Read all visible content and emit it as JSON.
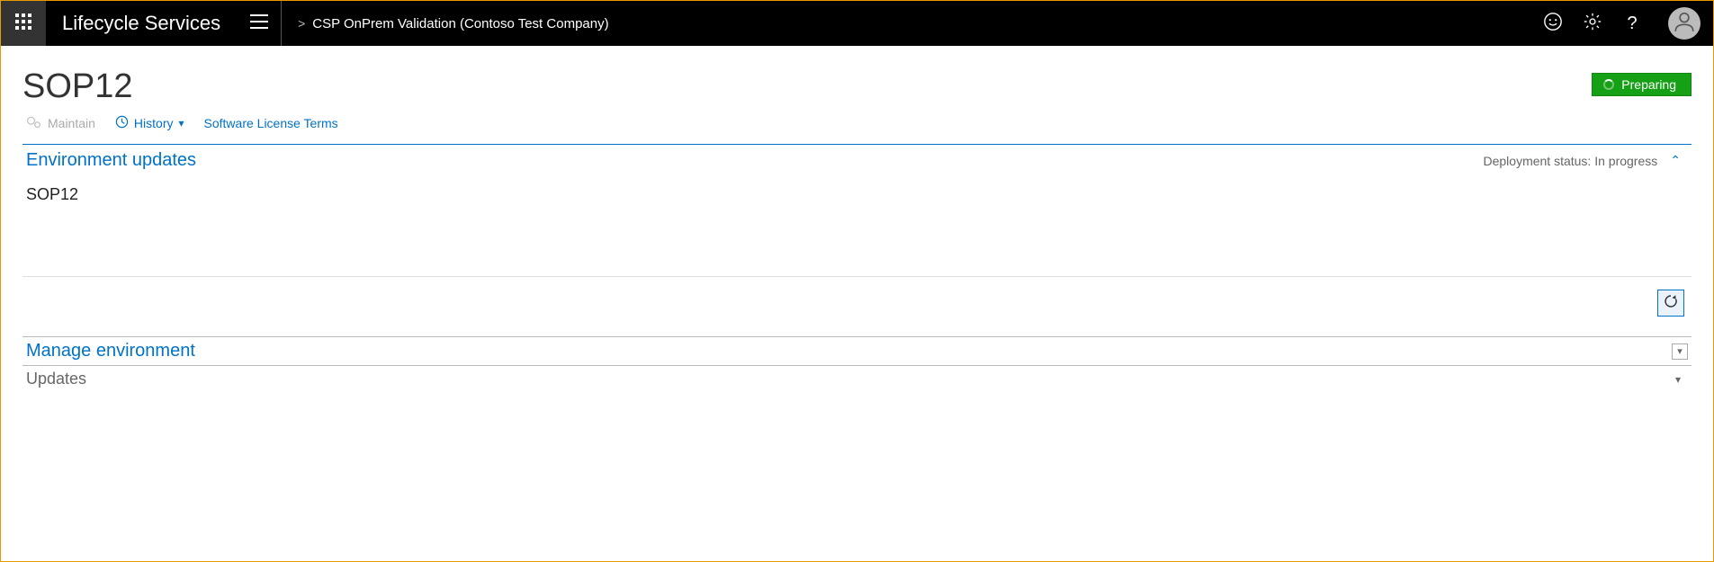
{
  "header": {
    "brand": "Lifecycle Services",
    "breadcrumb_sep": ">",
    "breadcrumb_project": "CSP OnPrem Validation (Contoso Test Company)"
  },
  "page": {
    "title": "SOP12",
    "status_label": "Preparing"
  },
  "toolbar": {
    "maintain_label": "Maintain",
    "history_label": "History",
    "license_label": "Software License Terms"
  },
  "sections": {
    "environment_updates": {
      "title": "Environment updates",
      "deployment_status_label": "Deployment status:",
      "deployment_status_value": "In progress",
      "body_name": "SOP12"
    },
    "manage_environment": {
      "title": "Manage environment"
    },
    "updates": {
      "title": "Updates"
    }
  }
}
